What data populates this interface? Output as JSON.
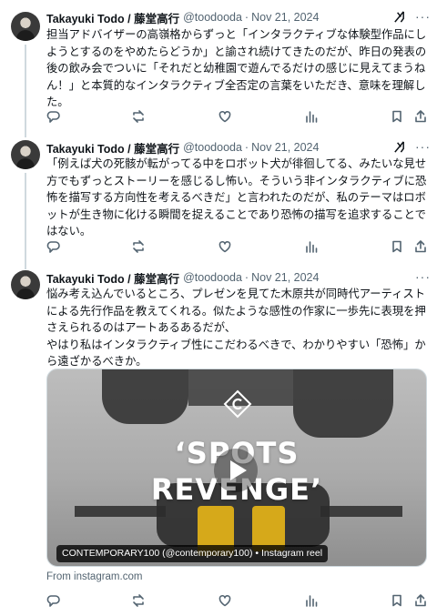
{
  "tweets": [
    {
      "author": "Takayuki Todo / 藤堂高行",
      "handle": "@toodooda",
      "separator": "·",
      "date": "Nov 21, 2024",
      "text": "担当アドバイザーの高嶺格からずっと「インタラクティブな体験型作品にしようとするのをやめたらどうか」と諭され続けてきたのだが、昨日の発表の後の飲み会でついに「それだと幼稚園で遊んでるだけの感じに見えてまうねん！」と本質的なインタラクティブ全否定の言葉をいただき、意味を理解した。"
    },
    {
      "author": "Takayuki Todo / 藤堂高行",
      "handle": "@toodooda",
      "separator": "·",
      "date": "Nov 21, 2024",
      "text": "「例えば犬の死骸が転がってる中をロボット犬が徘徊してる、みたいな見せ方でもずっとストーリーを感じるし怖い。そういう非インタラクティブに恐怖を描写する方向性を考えるべきだ」と言われたのだが、私のテーマはロボットが生き物に化ける瞬間を捉えることであり恐怖の描写を追求することではない。"
    },
    {
      "author": "Takayuki Todo / 藤堂高行",
      "handle": "@toodooda",
      "separator": "·",
      "date": "Nov 21, 2024",
      "text_lines": [
        "悩み考え込んでいるところ、プレゼンを見てた木原共が同時代アーティストによる先行作品を教えてくれる。似たような感性の作家に一歩先に表現を押さえられるのはアートあるあるだが、",
        "やはり私はインタラクティブ性にこだわるべきで、わかりやすい「恐怖」から遠ざかるべきか。"
      ],
      "media": {
        "title_line1": "‘SPOTS",
        "title_line2": "REVENGE’",
        "caption": "CONTEMPORARY100 (@contemporary100) • Instagram reel"
      },
      "source": "From instagram.com"
    }
  ],
  "icons": {
    "reply": "reply-icon",
    "repost": "repost-icon",
    "like": "like-icon",
    "views": "views-icon",
    "bookmark": "bookmark-icon",
    "share": "share-icon",
    "grok": "grok-icon",
    "more": "more-icon",
    "play": "play-icon"
  },
  "colors": {
    "text": "#0f1419",
    "secondary": "#536471",
    "thread_line": "#cfd9de"
  }
}
